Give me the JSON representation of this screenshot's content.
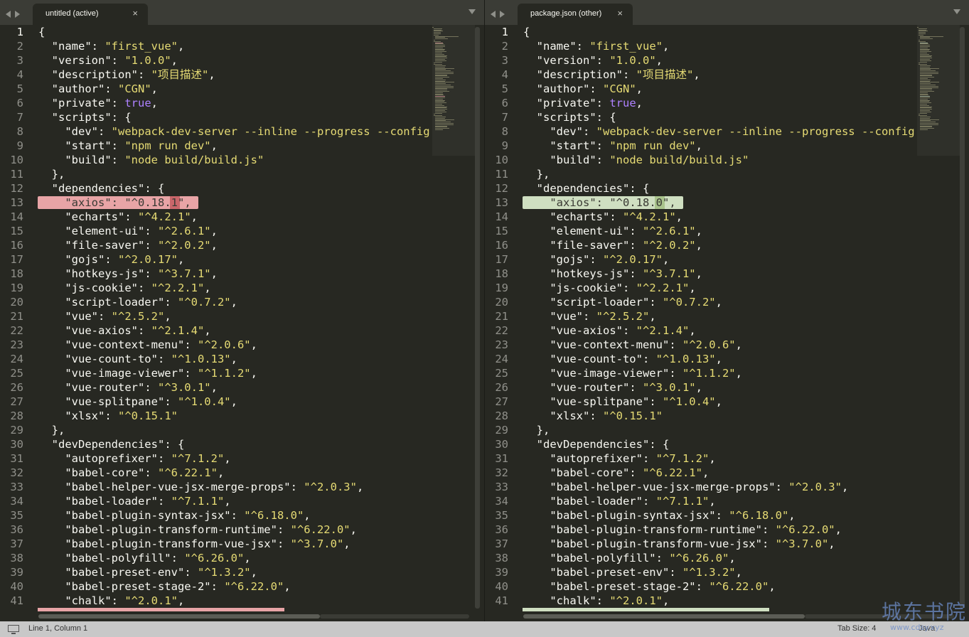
{
  "left": {
    "tab_title": "untitled (active)",
    "close_glyph": "×",
    "current_line": 1,
    "diff_color": "#e8a4a6",
    "diff_line": 13,
    "lines": [
      [
        [
          "p",
          "{"
        ]
      ],
      [
        [
          "k",
          "  \"name\""
        ],
        [
          "p",
          ": "
        ],
        [
          "s",
          "\"first_vue\""
        ],
        [
          "p",
          ","
        ]
      ],
      [
        [
          "k",
          "  \"version\""
        ],
        [
          "p",
          ": "
        ],
        [
          "s",
          "\"1.0.0\""
        ],
        [
          "p",
          ","
        ]
      ],
      [
        [
          "k",
          "  \"description\""
        ],
        [
          "p",
          ": "
        ],
        [
          "s",
          "\"项目描述\""
        ],
        [
          "p",
          ","
        ]
      ],
      [
        [
          "k",
          "  \"author\""
        ],
        [
          "p",
          ": "
        ],
        [
          "s",
          "\"CGN\""
        ],
        [
          "p",
          ","
        ]
      ],
      [
        [
          "k",
          "  \"private\""
        ],
        [
          "p",
          ": "
        ],
        [
          "b",
          "true"
        ],
        [
          "p",
          ","
        ]
      ],
      [
        [
          "k",
          "  \"scripts\""
        ],
        [
          "p",
          ": {"
        ]
      ],
      [
        [
          "k",
          "    \"dev\""
        ],
        [
          "p",
          ": "
        ],
        [
          "s",
          "\"webpack-dev-server --inline --progress --config"
        ]
      ],
      [
        [
          "k",
          "    \"start\""
        ],
        [
          "p",
          ": "
        ],
        [
          "s",
          "\"npm run dev\""
        ],
        [
          "p",
          ","
        ]
      ],
      [
        [
          "k",
          "    \"build\""
        ],
        [
          "p",
          ": "
        ],
        [
          "s",
          "\"node build/build.js\""
        ]
      ],
      [
        [
          "p",
          "  },"
        ]
      ],
      [
        [
          "k",
          "  \"dependencies\""
        ],
        [
          "p",
          ": {"
        ]
      ],
      [
        [
          "k",
          "    \"axios\""
        ],
        [
          "p",
          ": "
        ],
        [
          "s",
          "\"^0.18.1\""
        ],
        [
          "p",
          ","
        ]
      ],
      [
        [
          "k",
          "    \"echarts\""
        ],
        [
          "p",
          ": "
        ],
        [
          "s",
          "\"^4.2.1\""
        ],
        [
          "p",
          ","
        ]
      ],
      [
        [
          "k",
          "    \"element-ui\""
        ],
        [
          "p",
          ": "
        ],
        [
          "s",
          "\"^2.6.1\""
        ],
        [
          "p",
          ","
        ]
      ],
      [
        [
          "k",
          "    \"file-saver\""
        ],
        [
          "p",
          ": "
        ],
        [
          "s",
          "\"^2.0.2\""
        ],
        [
          "p",
          ","
        ]
      ],
      [
        [
          "k",
          "    \"gojs\""
        ],
        [
          "p",
          ": "
        ],
        [
          "s",
          "\"^2.0.17\""
        ],
        [
          "p",
          ","
        ]
      ],
      [
        [
          "k",
          "    \"hotkeys-js\""
        ],
        [
          "p",
          ": "
        ],
        [
          "s",
          "\"^3.7.1\""
        ],
        [
          "p",
          ","
        ]
      ],
      [
        [
          "k",
          "    \"js-cookie\""
        ],
        [
          "p",
          ": "
        ],
        [
          "s",
          "\"^2.2.1\""
        ],
        [
          "p",
          ","
        ]
      ],
      [
        [
          "k",
          "    \"script-loader\""
        ],
        [
          "p",
          ": "
        ],
        [
          "s",
          "\"^0.7.2\""
        ],
        [
          "p",
          ","
        ]
      ],
      [
        [
          "k",
          "    \"vue\""
        ],
        [
          "p",
          ": "
        ],
        [
          "s",
          "\"^2.5.2\""
        ],
        [
          "p",
          ","
        ]
      ],
      [
        [
          "k",
          "    \"vue-axios\""
        ],
        [
          "p",
          ": "
        ],
        [
          "s",
          "\"^2.1.4\""
        ],
        [
          "p",
          ","
        ]
      ],
      [
        [
          "k",
          "    \"vue-context-menu\""
        ],
        [
          "p",
          ": "
        ],
        [
          "s",
          "\"^2.0.6\""
        ],
        [
          "p",
          ","
        ]
      ],
      [
        [
          "k",
          "    \"vue-count-to\""
        ],
        [
          "p",
          ": "
        ],
        [
          "s",
          "\"^1.0.13\""
        ],
        [
          "p",
          ","
        ]
      ],
      [
        [
          "k",
          "    \"vue-image-viewer\""
        ],
        [
          "p",
          ": "
        ],
        [
          "s",
          "\"^1.1.2\""
        ],
        [
          "p",
          ","
        ]
      ],
      [
        [
          "k",
          "    \"vue-router\""
        ],
        [
          "p",
          ": "
        ],
        [
          "s",
          "\"^3.0.1\""
        ],
        [
          "p",
          ","
        ]
      ],
      [
        [
          "k",
          "    \"vue-splitpane\""
        ],
        [
          "p",
          ": "
        ],
        [
          "s",
          "\"^1.0.4\""
        ],
        [
          "p",
          ","
        ]
      ],
      [
        [
          "k",
          "    \"xlsx\""
        ],
        [
          "p",
          ": "
        ],
        [
          "s",
          "\"^0.15.1\""
        ]
      ],
      [
        [
          "p",
          "  },"
        ]
      ],
      [
        [
          "k",
          "  \"devDependencies\""
        ],
        [
          "p",
          ": {"
        ]
      ],
      [
        [
          "k",
          "    \"autoprefixer\""
        ],
        [
          "p",
          ": "
        ],
        [
          "s",
          "\"^7.1.2\""
        ],
        [
          "p",
          ","
        ]
      ],
      [
        [
          "k",
          "    \"babel-core\""
        ],
        [
          "p",
          ": "
        ],
        [
          "s",
          "\"^6.22.1\""
        ],
        [
          "p",
          ","
        ]
      ],
      [
        [
          "k",
          "    \"babel-helper-vue-jsx-merge-props\""
        ],
        [
          "p",
          ": "
        ],
        [
          "s",
          "\"^2.0.3\""
        ],
        [
          "p",
          ","
        ]
      ],
      [
        [
          "k",
          "    \"babel-loader\""
        ],
        [
          "p",
          ": "
        ],
        [
          "s",
          "\"^7.1.1\""
        ],
        [
          "p",
          ","
        ]
      ],
      [
        [
          "k",
          "    \"babel-plugin-syntax-jsx\""
        ],
        [
          "p",
          ": "
        ],
        [
          "s",
          "\"^6.18.0\""
        ],
        [
          "p",
          ","
        ]
      ],
      [
        [
          "k",
          "    \"babel-plugin-transform-runtime\""
        ],
        [
          "p",
          ": "
        ],
        [
          "s",
          "\"^6.22.0\""
        ],
        [
          "p",
          ","
        ]
      ],
      [
        [
          "k",
          "    \"babel-plugin-transform-vue-jsx\""
        ],
        [
          "p",
          ": "
        ],
        [
          "s",
          "\"^3.7.0\""
        ],
        [
          "p",
          ","
        ]
      ],
      [
        [
          "k",
          "    \"babel-polyfill\""
        ],
        [
          "p",
          ": "
        ],
        [
          "s",
          "\"^6.26.0\""
        ],
        [
          "p",
          ","
        ]
      ],
      [
        [
          "k",
          "    \"babel-preset-env\""
        ],
        [
          "p",
          ": "
        ],
        [
          "s",
          "\"^1.3.2\""
        ],
        [
          "p",
          ","
        ]
      ],
      [
        [
          "k",
          "    \"babel-preset-stage-2\""
        ],
        [
          "p",
          ": "
        ],
        [
          "s",
          "\"^6.22.0\""
        ],
        [
          "p",
          ","
        ]
      ],
      [
        [
          "k",
          "    \"chalk\""
        ],
        [
          "p",
          ": "
        ],
        [
          "s",
          "\"^2.0.1\""
        ],
        [
          "p",
          ","
        ]
      ]
    ]
  },
  "right": {
    "tab_title": "package.json (other)",
    "close_glyph": "×",
    "current_line": 1,
    "diff_color": "#cfdfc1",
    "diff_line": 13,
    "lines": [
      [
        [
          "p",
          "{"
        ]
      ],
      [
        [
          "k",
          "  \"name\""
        ],
        [
          "p",
          ": "
        ],
        [
          "s",
          "\"first_vue\""
        ],
        [
          "p",
          ","
        ]
      ],
      [
        [
          "k",
          "  \"version\""
        ],
        [
          "p",
          ": "
        ],
        [
          "s",
          "\"1.0.0\""
        ],
        [
          "p",
          ","
        ]
      ],
      [
        [
          "k",
          "  \"description\""
        ],
        [
          "p",
          ": "
        ],
        [
          "s",
          "\"项目描述\""
        ],
        [
          "p",
          ","
        ]
      ],
      [
        [
          "k",
          "  \"author\""
        ],
        [
          "p",
          ": "
        ],
        [
          "s",
          "\"CGN\""
        ],
        [
          "p",
          ","
        ]
      ],
      [
        [
          "k",
          "  \"private\""
        ],
        [
          "p",
          ": "
        ],
        [
          "b",
          "true"
        ],
        [
          "p",
          ","
        ]
      ],
      [
        [
          "k",
          "  \"scripts\""
        ],
        [
          "p",
          ": {"
        ]
      ],
      [
        [
          "k",
          "    \"dev\""
        ],
        [
          "p",
          ": "
        ],
        [
          "s",
          "\"webpack-dev-server --inline --progress --config"
        ]
      ],
      [
        [
          "k",
          "    \"start\""
        ],
        [
          "p",
          ": "
        ],
        [
          "s",
          "\"npm run dev\""
        ],
        [
          "p",
          ","
        ]
      ],
      [
        [
          "k",
          "    \"build\""
        ],
        [
          "p",
          ": "
        ],
        [
          "s",
          "\"node build/build.js\""
        ]
      ],
      [
        [
          "p",
          "  },"
        ]
      ],
      [
        [
          "k",
          "  \"dependencies\""
        ],
        [
          "p",
          ": {"
        ]
      ],
      [
        [
          "k",
          "    \"axios\""
        ],
        [
          "p",
          ": "
        ],
        [
          "s",
          "\"^0.18.0\""
        ],
        [
          "p",
          ","
        ]
      ],
      [
        [
          "k",
          "    \"echarts\""
        ],
        [
          "p",
          ": "
        ],
        [
          "s",
          "\"^4.2.1\""
        ],
        [
          "p",
          ","
        ]
      ],
      [
        [
          "k",
          "    \"element-ui\""
        ],
        [
          "p",
          ": "
        ],
        [
          "s",
          "\"^2.6.1\""
        ],
        [
          "p",
          ","
        ]
      ],
      [
        [
          "k",
          "    \"file-saver\""
        ],
        [
          "p",
          ": "
        ],
        [
          "s",
          "\"^2.0.2\""
        ],
        [
          "p",
          ","
        ]
      ],
      [
        [
          "k",
          "    \"gojs\""
        ],
        [
          "p",
          ": "
        ],
        [
          "s",
          "\"^2.0.17\""
        ],
        [
          "p",
          ","
        ]
      ],
      [
        [
          "k",
          "    \"hotkeys-js\""
        ],
        [
          "p",
          ": "
        ],
        [
          "s",
          "\"^3.7.1\""
        ],
        [
          "p",
          ","
        ]
      ],
      [
        [
          "k",
          "    \"js-cookie\""
        ],
        [
          "p",
          ": "
        ],
        [
          "s",
          "\"^2.2.1\""
        ],
        [
          "p",
          ","
        ]
      ],
      [
        [
          "k",
          "    \"script-loader\""
        ],
        [
          "p",
          ": "
        ],
        [
          "s",
          "\"^0.7.2\""
        ],
        [
          "p",
          ","
        ]
      ],
      [
        [
          "k",
          "    \"vue\""
        ],
        [
          "p",
          ": "
        ],
        [
          "s",
          "\"^2.5.2\""
        ],
        [
          "p",
          ","
        ]
      ],
      [
        [
          "k",
          "    \"vue-axios\""
        ],
        [
          "p",
          ": "
        ],
        [
          "s",
          "\"^2.1.4\""
        ],
        [
          "p",
          ","
        ]
      ],
      [
        [
          "k",
          "    \"vue-context-menu\""
        ],
        [
          "p",
          ": "
        ],
        [
          "s",
          "\"^2.0.6\""
        ],
        [
          "p",
          ","
        ]
      ],
      [
        [
          "k",
          "    \"vue-count-to\""
        ],
        [
          "p",
          ": "
        ],
        [
          "s",
          "\"^1.0.13\""
        ],
        [
          "p",
          ","
        ]
      ],
      [
        [
          "k",
          "    \"vue-image-viewer\""
        ],
        [
          "p",
          ": "
        ],
        [
          "s",
          "\"^1.1.2\""
        ],
        [
          "p",
          ","
        ]
      ],
      [
        [
          "k",
          "    \"vue-router\""
        ],
        [
          "p",
          ": "
        ],
        [
          "s",
          "\"^3.0.1\""
        ],
        [
          "p",
          ","
        ]
      ],
      [
        [
          "k",
          "    \"vue-splitpane\""
        ],
        [
          "p",
          ": "
        ],
        [
          "s",
          "\"^1.0.4\""
        ],
        [
          "p",
          ","
        ]
      ],
      [
        [
          "k",
          "    \"xlsx\""
        ],
        [
          "p",
          ": "
        ],
        [
          "s",
          "\"^0.15.1\""
        ]
      ],
      [
        [
          "p",
          "  },"
        ]
      ],
      [
        [
          "k",
          "  \"devDependencies\""
        ],
        [
          "p",
          ": {"
        ]
      ],
      [
        [
          "k",
          "    \"autoprefixer\""
        ],
        [
          "p",
          ": "
        ],
        [
          "s",
          "\"^7.1.2\""
        ],
        [
          "p",
          ","
        ]
      ],
      [
        [
          "k",
          "    \"babel-core\""
        ],
        [
          "p",
          ": "
        ],
        [
          "s",
          "\"^6.22.1\""
        ],
        [
          "p",
          ","
        ]
      ],
      [
        [
          "k",
          "    \"babel-helper-vue-jsx-merge-props\""
        ],
        [
          "p",
          ": "
        ],
        [
          "s",
          "\"^2.0.3\""
        ],
        [
          "p",
          ","
        ]
      ],
      [
        [
          "k",
          "    \"babel-loader\""
        ],
        [
          "p",
          ": "
        ],
        [
          "s",
          "\"^7.1.1\""
        ],
        [
          "p",
          ","
        ]
      ],
      [
        [
          "k",
          "    \"babel-plugin-syntax-jsx\""
        ],
        [
          "p",
          ": "
        ],
        [
          "s",
          "\"^6.18.0\""
        ],
        [
          "p",
          ","
        ]
      ],
      [
        [
          "k",
          "    \"babel-plugin-transform-runtime\""
        ],
        [
          "p",
          ": "
        ],
        [
          "s",
          "\"^6.22.0\""
        ],
        [
          "p",
          ","
        ]
      ],
      [
        [
          "k",
          "    \"babel-plugin-transform-vue-jsx\""
        ],
        [
          "p",
          ": "
        ],
        [
          "s",
          "\"^3.7.0\""
        ],
        [
          "p",
          ","
        ]
      ],
      [
        [
          "k",
          "    \"babel-polyfill\""
        ],
        [
          "p",
          ": "
        ],
        [
          "s",
          "\"^6.26.0\""
        ],
        [
          "p",
          ","
        ]
      ],
      [
        [
          "k",
          "    \"babel-preset-env\""
        ],
        [
          "p",
          ": "
        ],
        [
          "s",
          "\"^1.3.2\""
        ],
        [
          "p",
          ","
        ]
      ],
      [
        [
          "k",
          "    \"babel-preset-stage-2\""
        ],
        [
          "p",
          ": "
        ],
        [
          "s",
          "\"^6.22.0\""
        ],
        [
          "p",
          ","
        ]
      ],
      [
        [
          "k",
          "    \"chalk\""
        ],
        [
          "p",
          ": "
        ],
        [
          "s",
          "\"^2.0.1\""
        ],
        [
          "p",
          ","
        ]
      ]
    ]
  },
  "statusbar": {
    "position": "Line 1, Column 1",
    "tab_size": "Tab Size: 4",
    "syntax": "Java"
  },
  "watermark": {
    "text": "城东书院",
    "sub": "www.cdsy.xyz"
  },
  "colors": {
    "background": "#272822",
    "string": "#e6db74",
    "keyword": "#ae81ff",
    "removed": "#e8a4a6",
    "added": "#cfdfc1"
  },
  "icons": [
    "nav-left-icon",
    "nav-right-icon",
    "close-icon",
    "tab-menu-icon",
    "monitor-icon"
  ]
}
